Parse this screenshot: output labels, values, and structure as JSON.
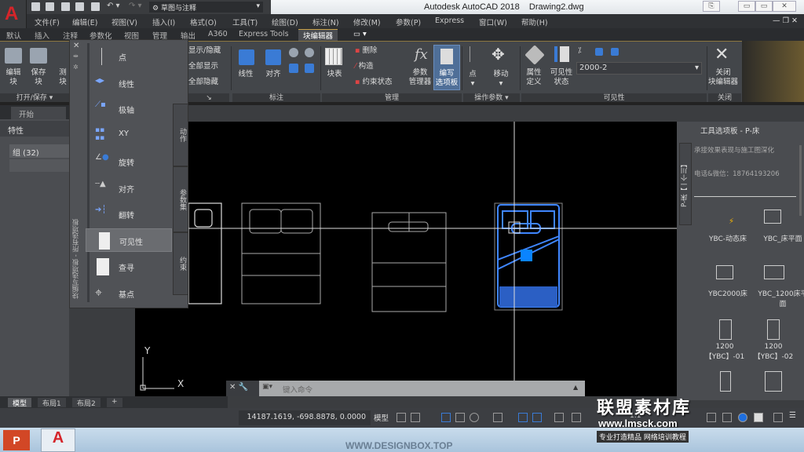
{
  "app": {
    "logo": "A",
    "title": "Autodesk AutoCAD 2018    Drawing2.dwg",
    "workspace": "草图与注释"
  },
  "window_controls": [
    "▭",
    "▭",
    "✕"
  ],
  "doc_controls": "— ❐ ✕",
  "menu": [
    "文件(F)",
    "编辑(E)",
    "视图(V)",
    "插入(I)",
    "格式(O)",
    "工具(T)",
    "绘图(D)",
    "标注(N)",
    "修改(M)",
    "参数(P)",
    "Express",
    "窗口(W)",
    "帮助(H)"
  ],
  "ribbon_tabs": [
    "默认",
    "插入",
    "注释",
    "参数化",
    "视图",
    "管理",
    "输出",
    "A360",
    "Express Tools",
    "块编辑器"
  ],
  "active_tab": "块编辑器",
  "ribbon": {
    "open_save": {
      "title": "打开/保存",
      "edit_block": "编辑\n块",
      "save_block": "保存\n块",
      "test": "测\n块"
    },
    "geometry": {
      "show_hide": "显示/隐藏",
      "show_all": "全部显示",
      "hide_all": "全部隐藏",
      "side": "几何"
    },
    "dimension": {
      "title": "标注",
      "linear": "线性",
      "aligned": "对齐"
    },
    "manage": {
      "title": "管理",
      "block_table": "块表",
      "delete": "删除",
      "construct": "构造",
      "constraint_status": "约束状态",
      "param_manager": "参数\n管理器",
      "authoring_palettes": "编写\n选项板"
    },
    "action_params": {
      "title": "操作参数",
      "point": "点",
      "move": "移动"
    },
    "attr_def": "属性\n定义",
    "visibility": {
      "title": "可见性",
      "states": "可见性\n状态",
      "current": "2000-2"
    },
    "close": {
      "title": "关闭",
      "close_editor": "关闭\n块编辑器"
    }
  },
  "file_tab": "开始",
  "properties": {
    "title": "特性",
    "selection": "组 (32)"
  },
  "authoring_palette": {
    "title": "块编写选项板 - 所有选项板",
    "items": [
      "点",
      "线性",
      "极轴",
      "XY",
      "旋转",
      "对齐",
      "翻转",
      "可见性",
      "查寻",
      "基点"
    ],
    "selected": "可见性",
    "side_tabs": [
      "动作",
      "参数集",
      "约束"
    ]
  },
  "tool_palette": {
    "title": "工具选项板 - P-床",
    "side_tab": "P-床【一个川】",
    "line1": "承接效果表现与施工图深化",
    "line2": "电话&微信：18764193206",
    "tools": [
      "YBC-动态床",
      "YBC_床平面",
      "YBC2000床",
      "YBC_1200床平面",
      "1200\n【YBC】-01",
      "1200\n【YBC】-02"
    ]
  },
  "ucs": {
    "x": "X",
    "y": "Y"
  },
  "command": {
    "placeholder": "键入命令"
  },
  "layout_tabs": [
    "模型",
    "布局1",
    "布局2",
    "+"
  ],
  "status": {
    "coords": "14187.1619, -698.8878, 0.0000",
    "space": "模型",
    "scale": "1:1"
  },
  "watermark": {
    "name": "联盟素材库",
    "url": "www.lmsck.com",
    "slogan": "专业打造精品 网络培训教程",
    "footer": "WWW.DESIGNBOX.TOP"
  },
  "colors": {
    "accent": "#c9a24a",
    "selection": "#2f6fe0",
    "logo_red": "#d5252a"
  }
}
